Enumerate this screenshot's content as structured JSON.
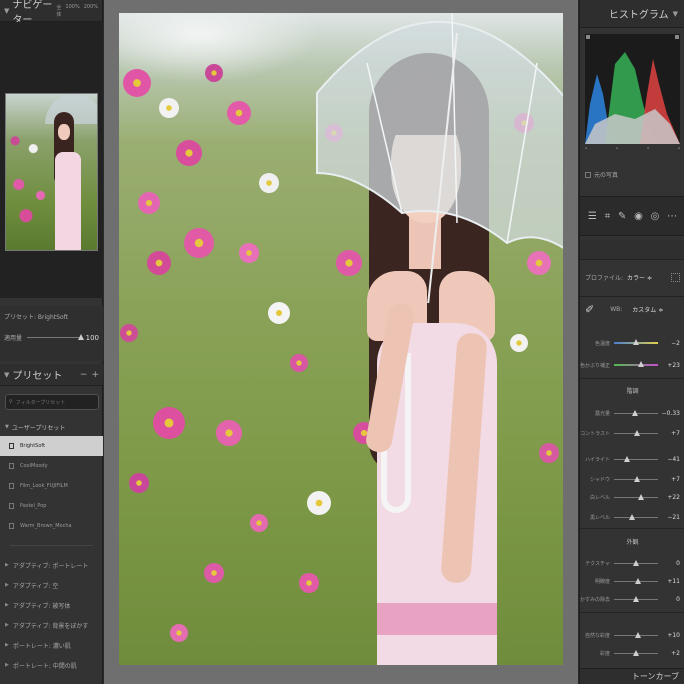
{
  "left_panel": {
    "navigator": {
      "title": "ナビゲーター",
      "zoom_options": [
        "全体",
        "100%",
        "200%"
      ]
    },
    "preset_info": {
      "preset_label": "プリセット: BrightSoft",
      "amount_label": "適用量",
      "amount_value": "100",
      "amount_fraction": 1.0
    },
    "presets": {
      "title": "プリセット",
      "actions": [
        "−",
        "+"
      ],
      "search_placeholder": "フィルタープリセット",
      "user_group": "ユーザープリセット",
      "items": [
        "BrightSoft",
        "CoolMoody",
        "Film_Look_FUJIFILM",
        "Pastel_Pop",
        "Warm_Brown_Mocha"
      ],
      "selected": "BrightSoft",
      "closed_groups": [
        "アダプティブ: ポートレート",
        "アダプティブ: 空",
        "アダプティブ: 被写体",
        "アダプティブ: 背景をぼかす",
        "ポートレート: 濃い肌",
        "ポートレート: 中間の肌"
      ]
    }
  },
  "right_panel": {
    "histogram": {
      "title": "ヒストグラム"
    },
    "original_photo": "元の写真",
    "profile": {
      "label": "プロファイル:",
      "value": "カラー ≑"
    },
    "wb": {
      "label": "WB:",
      "value": "カスタム ≑"
    },
    "sections": {
      "tone": "階調",
      "presence": "外観"
    },
    "sliders": [
      {
        "label": "色温度",
        "value": "−2",
        "fraction": 0.49,
        "style": "temp"
      },
      {
        "label": "色かぶり補正",
        "value": "+23",
        "fraction": 0.61,
        "style": "tint"
      },
      {
        "label": "露光量",
        "value": "−0.33",
        "fraction": 0.47,
        "style": "plain"
      },
      {
        "label": "コントラスト",
        "value": "+7",
        "fraction": 0.53,
        "style": "plain"
      },
      {
        "label": "ハイライト",
        "value": "−41",
        "fraction": 0.3,
        "style": "plain"
      },
      {
        "label": "シャドウ",
        "value": "+7",
        "fraction": 0.53,
        "style": "plain"
      },
      {
        "label": "白レベル",
        "value": "+22",
        "fraction": 0.61,
        "style": "plain"
      },
      {
        "label": "黒レベル",
        "value": "−21",
        "fraction": 0.4,
        "style": "plain"
      },
      {
        "label": "テクスチャ",
        "value": "0",
        "fraction": 0.5,
        "style": "plain"
      },
      {
        "label": "明瞭度",
        "value": "+11",
        "fraction": 0.55,
        "style": "plain"
      },
      {
        "label": "かすみの除去",
        "value": "0",
        "fraction": 0.5,
        "style": "plain"
      },
      {
        "label": "自然な彩度",
        "value": "+10",
        "fraction": 0.55,
        "style": "plain"
      },
      {
        "label": "彩度",
        "value": "+2",
        "fraction": 0.51,
        "style": "plain"
      }
    ],
    "tone_curve": {
      "title": "トーンカーブ"
    }
  }
}
